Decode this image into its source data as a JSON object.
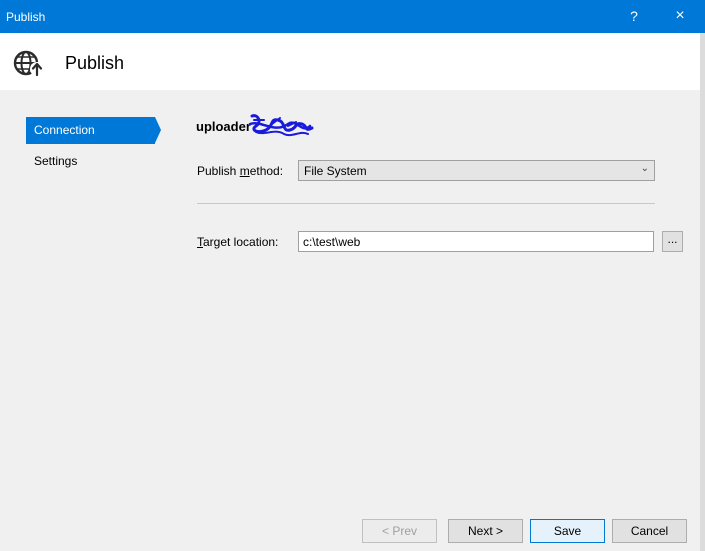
{
  "window": {
    "title": "Publish",
    "help": "?",
    "close": "×"
  },
  "header": {
    "title": "Publish",
    "icon": "globe-publish-icon"
  },
  "nav": {
    "items": [
      {
        "label": "Connection",
        "active": true
      },
      {
        "label": "Settings",
        "active": false
      }
    ]
  },
  "profile": {
    "name": "uploader"
  },
  "form": {
    "method_label_pre": "Publish ",
    "method_label_key": "m",
    "method_label_post": "ethod:",
    "method_value": "File System",
    "target_label_key": "T",
    "target_label_post": "arget location:",
    "target_value": "c:\\test\\web",
    "browse_label": "..."
  },
  "buttons": {
    "prev": "< Prev",
    "next": "Next >",
    "save": "Save",
    "cancel": "Cancel"
  },
  "colors": {
    "accent": "#0078d7",
    "background": "#f0f0f0"
  }
}
